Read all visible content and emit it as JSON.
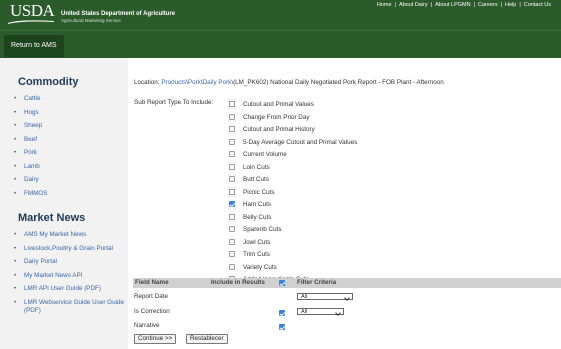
{
  "header": {
    "logo": "USDA",
    "department": "United States Department of Agriculture",
    "service": "Agricultural Marketing Service",
    "links": [
      "Home",
      "About Dairy",
      "About LPGMN",
      "Careers",
      "Help",
      "Contact Us"
    ]
  },
  "subbar": {
    "return_label": "Return to AMS"
  },
  "sidebar": {
    "commodity_title": "Commodity",
    "commodity_items": [
      "Cattle",
      "Hogs",
      "Sheep",
      "Beef",
      "Pork",
      "Lamb",
      "Dairy",
      "FMMOS"
    ],
    "market_news_title": "Market News",
    "market_news_items": [
      "AMS My Market News",
      "Livestock,Poultry & Grain Portal",
      "Dairy Portal",
      "My Market News API",
      "LMR API User Guide (PDF)",
      "LMR Webservice Guide User Guide (PDF)"
    ]
  },
  "location": {
    "prefix": "Location: ",
    "crumbs": [
      "Products",
      "Pork",
      "Daily Pork"
    ],
    "separator": "\\",
    "suffix": "\\(LM_PK602) National Daily Negotiated Pork Report - FOB Plant - Afternoon"
  },
  "sub_report": {
    "label": "Sub Report Type To Include:",
    "options": [
      {
        "label": "Cutout and Primal Values",
        "checked": false
      },
      {
        "label": "Change From Prior Day",
        "checked": false
      },
      {
        "label": "Cutout and Primal History",
        "checked": false
      },
      {
        "label": "5-Day Average Cutout and Primal Values",
        "checked": false
      },
      {
        "label": "Current Volume",
        "checked": false
      },
      {
        "label": "Loin Cuts",
        "checked": false
      },
      {
        "label": "Butt Cuts",
        "checked": false
      },
      {
        "label": "Picnic Cuts",
        "checked": false
      },
      {
        "label": "Ham Cuts",
        "checked": true
      },
      {
        "label": "Belly Cuts",
        "checked": false
      },
      {
        "label": "Sparerib Cuts",
        "checked": false
      },
      {
        "label": "Jowl Cuts",
        "checked": false
      },
      {
        "label": "Trim Cuts",
        "checked": false
      },
      {
        "label": "Variety Cuts",
        "checked": false
      },
      {
        "label": "Added Ingredients Cuts",
        "checked": false
      }
    ]
  },
  "filter_table": {
    "headers": {
      "field_name": "Field Name",
      "include": "Include in Results",
      "criteria": "Filter Criteria"
    },
    "header_checked": true,
    "rows": [
      {
        "label": "Report Date",
        "include": null,
        "select": "All"
      },
      {
        "label": "Is Correction",
        "include": true,
        "select": "All"
      },
      {
        "label": "Narrative",
        "include": true,
        "select": null
      }
    ]
  },
  "buttons": {
    "continue": "Continue >>",
    "reset": "Restablecer"
  },
  "colors": {
    "header_green": "#2b5a2b",
    "link_blue": "#3a66a8",
    "sidebar_bg": "#f2f2f2",
    "heading_navy": "#1e3a5a"
  }
}
